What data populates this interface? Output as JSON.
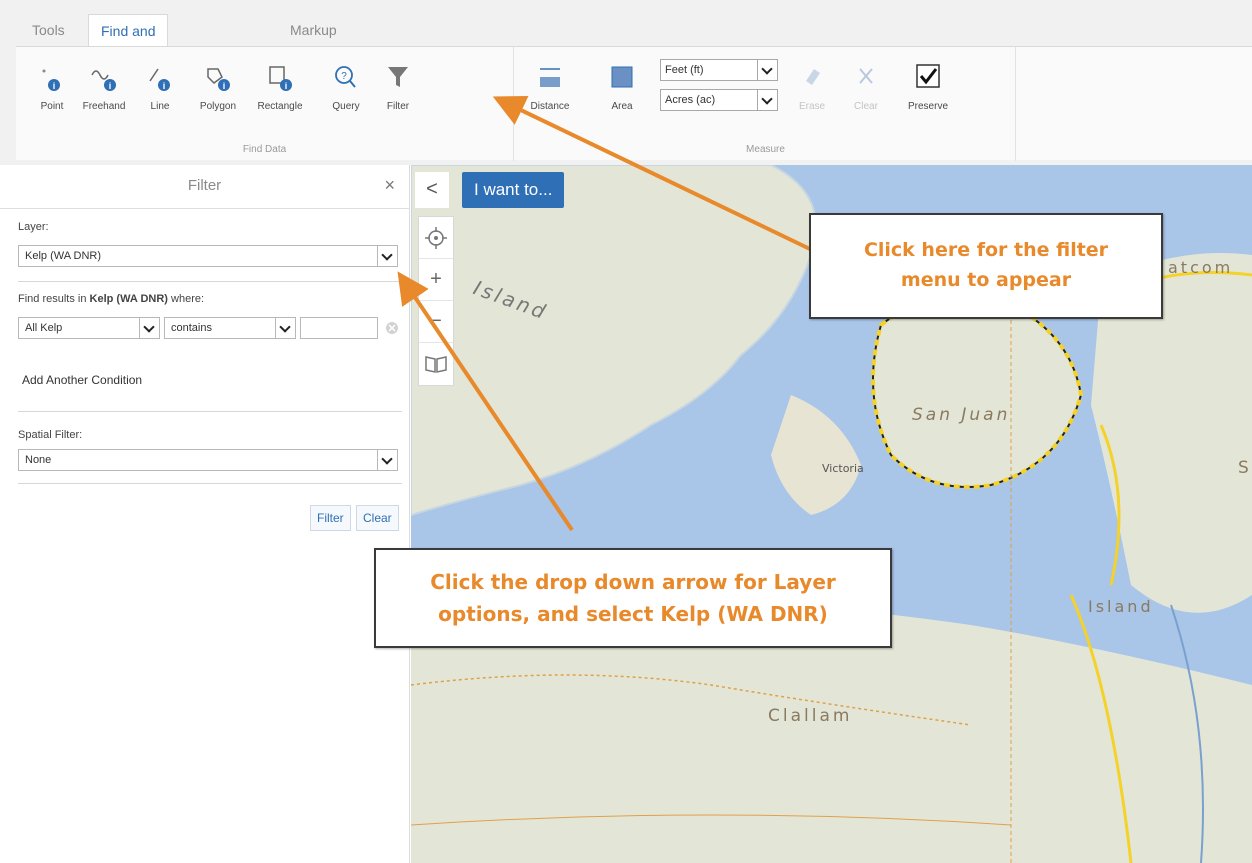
{
  "tabs": [
    "Tools",
    "Find and Measure",
    "Markup"
  ],
  "find_data": {
    "label": "Find Data",
    "tools": [
      "Point",
      "Freehand",
      "Line",
      "Polygon",
      "Rectangle",
      "Query",
      "Filter"
    ]
  },
  "measure": {
    "label": "Measure",
    "tools": [
      "Distance",
      "Area"
    ],
    "length_unit": "Feet (ft)",
    "area_unit": "Acres (ac)",
    "erase": "Erase",
    "clear": "Clear",
    "preserve": "Preserve"
  },
  "filter_panel": {
    "title": "Filter",
    "close": "×",
    "layer_label": "Layer:",
    "layer_value": "Kelp (WA DNR)",
    "find_prefix": "Find results in ",
    "find_layer": "Kelp (WA DNR)",
    "find_suffix": " where:",
    "field_value": "All Kelp",
    "operator_value": "contains",
    "value_text": "",
    "add_condition": "Add Another Condition",
    "spatial_label": "Spatial Filter:",
    "spatial_value": "None",
    "filter_button": "Filter",
    "clear_button": "Clear"
  },
  "map": {
    "collapse": "<",
    "i_want_to": "I want to...",
    "labels": {
      "island_top": "Island",
      "san_juan": "San Juan",
      "victoria": "Victoria",
      "island_right": "Island",
      "clallam": "Clallam",
      "whatcom": "atcom",
      "s": "S"
    },
    "colors": {
      "water": "#a9c5e8",
      "land": "#e3e6d6",
      "kelp": "#f4d22a"
    }
  },
  "callouts": {
    "top": [
      "Click here for the filter",
      "menu to appear"
    ],
    "bottom": [
      "Click the drop down arrow for Layer",
      "options, and select Kelp (WA DNR)"
    ],
    "color": "#e8892b"
  }
}
